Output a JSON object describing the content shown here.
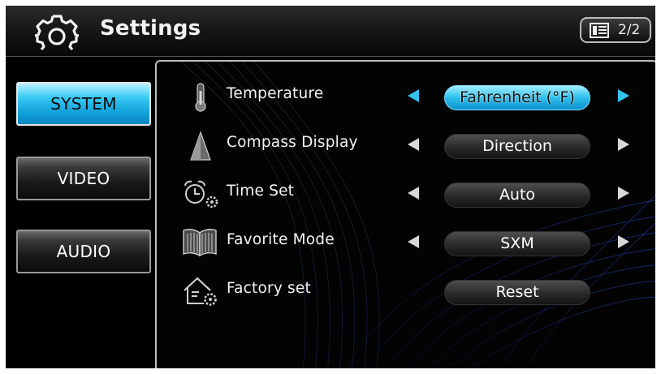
{
  "header": {
    "title": "Settings",
    "page_indicator": "2/2",
    "icons": [
      "gear-icon",
      "page-list-icon"
    ]
  },
  "nav": {
    "items": [
      {
        "label": "SYSTEM",
        "active": true
      },
      {
        "label": "VIDEO",
        "active": false
      },
      {
        "label": "AUDIO",
        "active": false
      }
    ]
  },
  "settings": {
    "temperature": {
      "label": "Temperature",
      "value": "Fahrenheit (°F)",
      "icon": "thermometer-icon",
      "selected": true
    },
    "compass": {
      "label": "Compass Display",
      "value": "Direction",
      "icon": "compass-triangle-icon"
    },
    "time": {
      "label": "Time Set",
      "value": "Auto",
      "icon": "alarm-clock-gear-icon"
    },
    "favorite": {
      "label": "Favorite Mode",
      "value": "SXM",
      "icon": "open-book-icon"
    },
    "factory": {
      "label": "Factory set",
      "value": "Reset",
      "icon": "house-gear-icon"
    }
  },
  "colors": {
    "accent": "#33c4f0",
    "background": "#000000",
    "text": "#f4f4f4"
  }
}
